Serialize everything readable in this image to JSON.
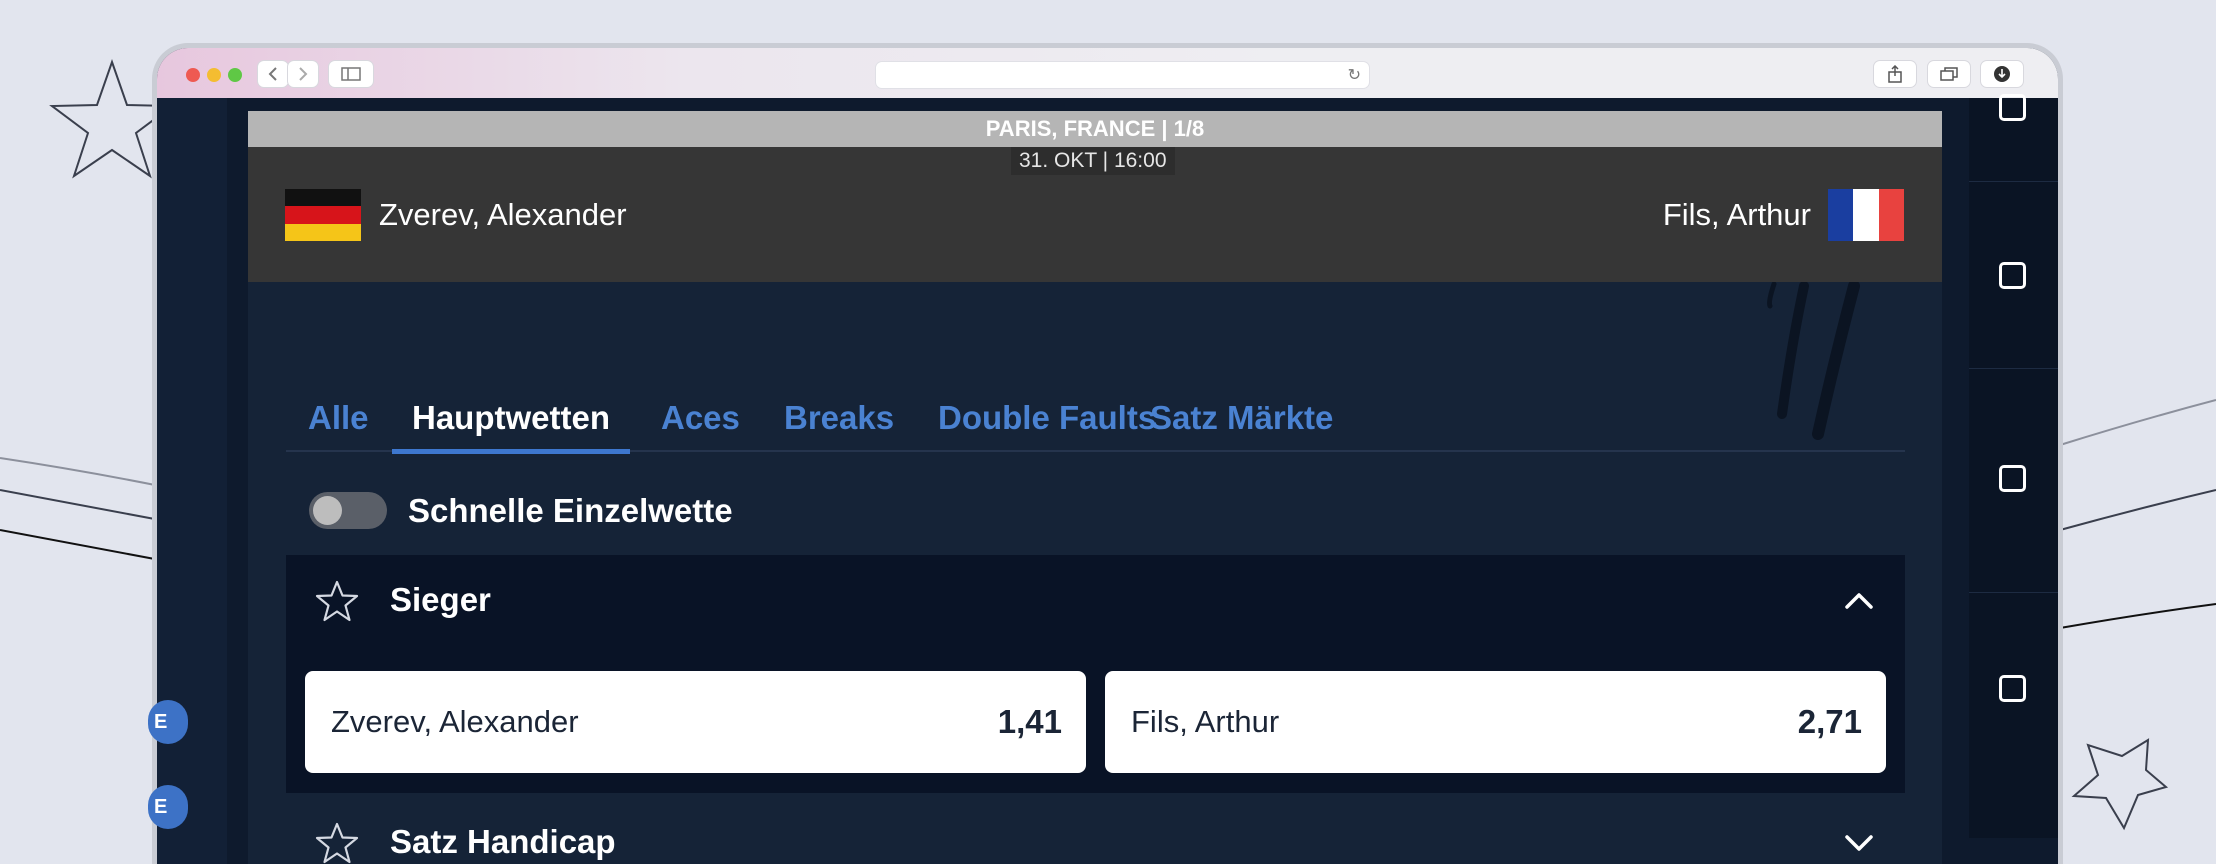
{
  "browser": {
    "back_icon": "chevron-left-icon",
    "forward_icon": "chevron-right-icon",
    "sidebar_icon": "sidebar-icon",
    "share_icon": "share-icon",
    "tabs_icon": "tabs-icon",
    "download_icon": "download-icon",
    "reload_icon": "reload-icon",
    "url": ""
  },
  "match": {
    "location": "PARIS, FRANCE  |  1/8",
    "date": "31. OKT | 16:00",
    "player1": {
      "name": "Zverev, Alexander",
      "flag": "germany-flag"
    },
    "player2": {
      "name": "Fils, Arthur",
      "flag": "france-flag"
    }
  },
  "tabs": [
    {
      "label": "Alle",
      "active": false
    },
    {
      "label": "Hauptwetten",
      "active": true
    },
    {
      "label": "Aces",
      "active": false
    },
    {
      "label": "Breaks",
      "active": false
    },
    {
      "label": "Double Faults",
      "active": false
    },
    {
      "label": "Satz Märkte",
      "active": false
    }
  ],
  "quick_bet": {
    "label": "Schnelle Einzelwette",
    "enabled": false
  },
  "markets": [
    {
      "title": "Sieger",
      "expanded": true,
      "odds": [
        {
          "name": "Zverev, Alexander",
          "value": "1,41"
        },
        {
          "name": "Fils, Arthur",
          "value": "2,71"
        }
      ]
    },
    {
      "title": "Satz Handicap",
      "expanded": false
    }
  ],
  "side_pills": [
    "E",
    "E"
  ],
  "colors": {
    "page_bg": "#e2e5ee",
    "app_bg": "#152337",
    "accent": "#3d77cf",
    "tab_inactive": "#4a82d2",
    "header_bg": "#363636",
    "location_bar": "#b5b5b5"
  }
}
